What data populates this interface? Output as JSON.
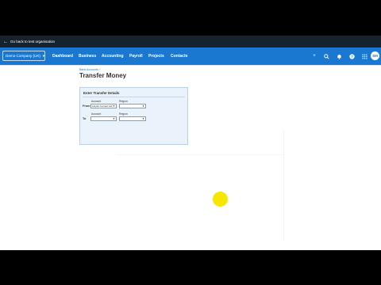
{
  "backbar": {
    "label": "Go back to test organisation"
  },
  "nav": {
    "org_name": "Demo Company (UK)",
    "items": [
      {
        "label": "Dashboard"
      },
      {
        "label": "Business"
      },
      {
        "label": "Accounting"
      },
      {
        "label": "Payroll"
      },
      {
        "label": "Projects"
      },
      {
        "label": "Contacts"
      }
    ],
    "avatar_initials": "SM",
    "icons": [
      "plus-icon",
      "search-icon",
      "bell-icon",
      "help-icon",
      "apps-grid-icon"
    ]
  },
  "page": {
    "breadcrumb": "Bank Accounts ›",
    "title": "Transfer Money"
  },
  "panel": {
    "title": "Enter Transfer Details",
    "from_label": "From",
    "to_label": "To",
    "account_label": "Account",
    "region_label": "Region",
    "from_account_value": "Lloyds Current Acc",
    "from_region_value": "",
    "to_account_value": "",
    "to_region_value": ""
  },
  "colors": {
    "nav_bg": "#1a78d1",
    "backbar_bg": "#16232f",
    "panel_bg": "#eaf2fb",
    "cursor_highlight": "#f7e600"
  }
}
